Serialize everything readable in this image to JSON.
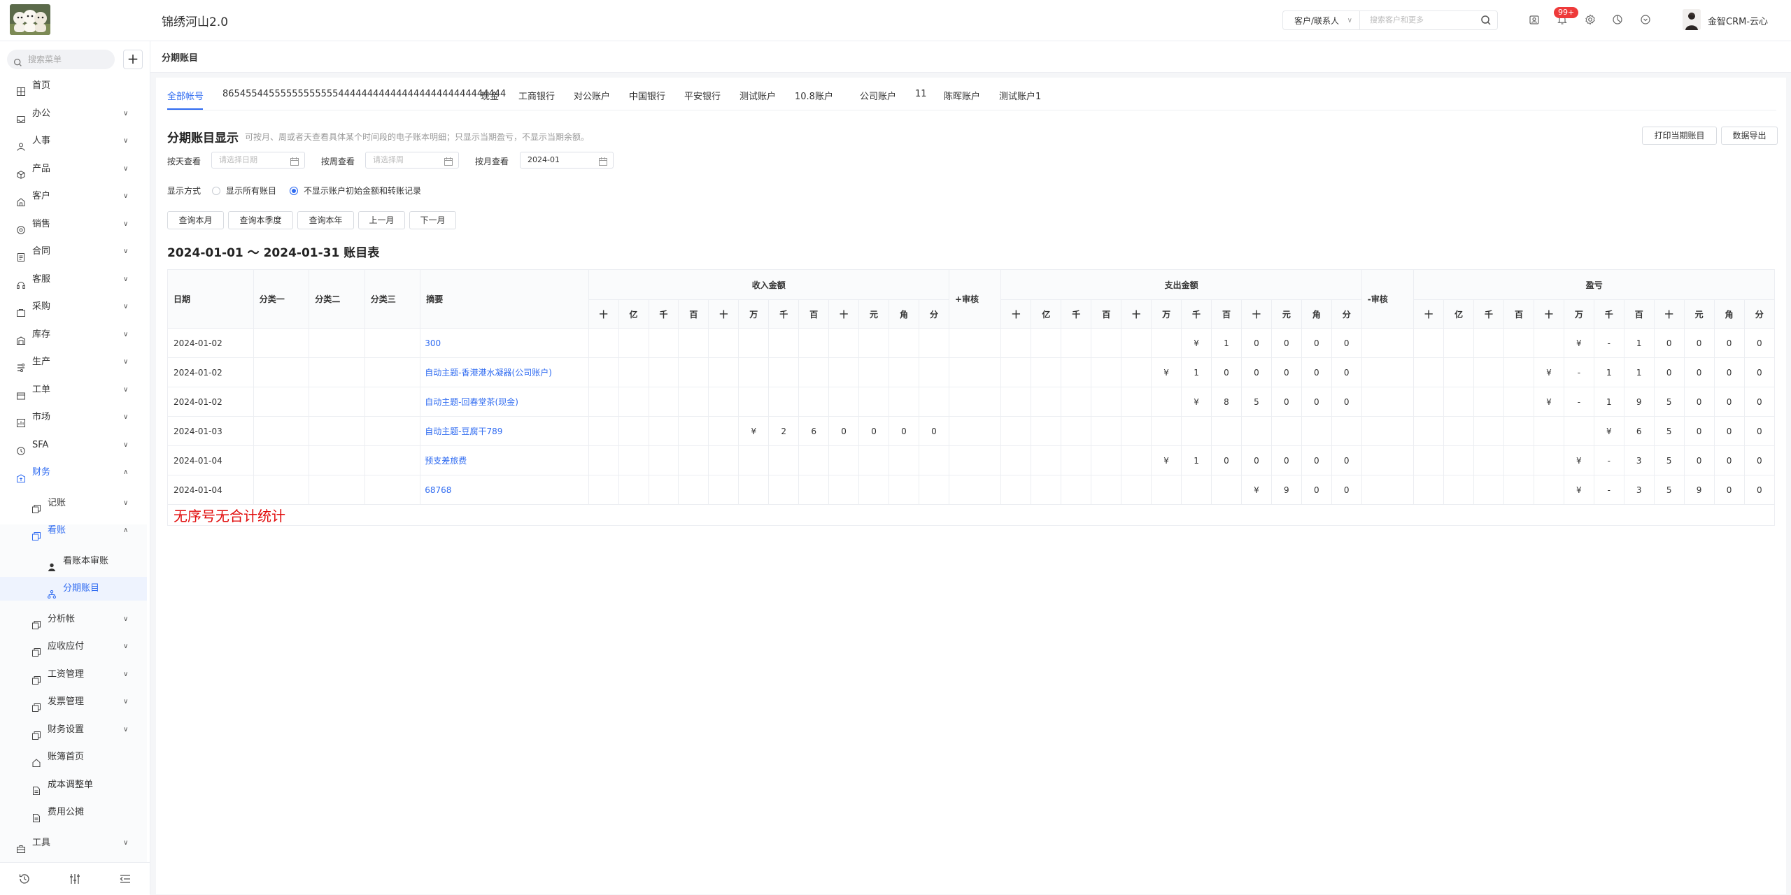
{
  "header": {
    "app_title": "锦绣河山2.0",
    "contact_type": "客户/联系人",
    "search_placeholder": "搜索客户和更多",
    "notif_count": "99+",
    "user_name": "金智CRM-云心"
  },
  "sidebar": {
    "search_placeholder": "搜索菜单",
    "items": [
      {
        "label": "首页",
        "icon": "grid-icon"
      },
      {
        "label": "办公",
        "icon": "inbox-icon"
      },
      {
        "label": "人事",
        "icon": "person-icon"
      },
      {
        "label": "产品",
        "icon": "box-icon"
      },
      {
        "label": "客户",
        "icon": "customer-icon"
      },
      {
        "label": "销售",
        "icon": "sales-icon"
      },
      {
        "label": "合同",
        "icon": "contract-icon"
      },
      {
        "label": "客服",
        "icon": "service-icon"
      },
      {
        "label": "采购",
        "icon": "cart-icon"
      },
      {
        "label": "库存",
        "icon": "warehouse-icon"
      },
      {
        "label": "生产",
        "icon": "production-icon"
      },
      {
        "label": "工单",
        "icon": "ticket-icon"
      },
      {
        "label": "市场",
        "icon": "market-icon"
      },
      {
        "label": "SFA",
        "icon": "sfa-icon"
      },
      {
        "label": "财务",
        "icon": "finance-icon"
      }
    ],
    "finance_children": [
      {
        "label": "记账",
        "icon": "copy-icon"
      },
      {
        "label": "看账",
        "icon": "copy-icon"
      },
      {
        "label": "看账本审账",
        "icon": "user-icon"
      },
      {
        "label": "分期账目",
        "icon": "tree-icon"
      },
      {
        "label": "分析帐",
        "icon": "copy-icon"
      },
      {
        "label": "应收应付",
        "icon": "copy-icon"
      },
      {
        "label": "工资管理",
        "icon": "copy-icon"
      },
      {
        "label": "发票管理",
        "icon": "copy-icon"
      },
      {
        "label": "财务设置",
        "icon": "copy-icon"
      },
      {
        "label": "账簿首页",
        "icon": "home-icon"
      },
      {
        "label": "成本调整单",
        "icon": "doc-icon"
      },
      {
        "label": "费用公摊",
        "icon": "doc-icon"
      }
    ],
    "tools_label": "工具"
  },
  "breadcrumb": {
    "title": "分期账目"
  },
  "tabs": [
    "全部帐号",
    "8654554455555555555544444444444444444444444444444",
    "现金",
    "工商银行",
    "对公账户",
    "中国银行",
    "平安银行",
    "测试账户",
    "10.8账户",
    "公司账户",
    "11",
    "陈晖账户",
    "测试账户1"
  ],
  "section": {
    "title": "分期账目显示",
    "hint": "可按月、周或者天查看具体某个时间段的电子账本明细；只显示当期盈亏，不显示当期余额。",
    "print_button": "打印当期账目",
    "export_button": "数据导出"
  },
  "filters": {
    "by_day_label": "按天查看",
    "by_day_placeholder": "请选择日期",
    "by_week_label": "按周查看",
    "by_week_placeholder": "请选择周",
    "by_month_label": "按月查看",
    "by_month_value": "2024-01",
    "display_label": "显示方式",
    "option_all": "显示所有账目",
    "option_hide": "不显示账户初始金额和转账记录",
    "quick_buttons": [
      "查询本月",
      "查询本季度",
      "查询本年",
      "上一月",
      "下一月"
    ]
  },
  "ledger": {
    "title": "2024-01-01 ～ 2024-01-31 账目表",
    "headers": {
      "date": "日期",
      "cat1": "分类一",
      "cat2": "分类二",
      "cat3": "分类三",
      "summary": "摘要",
      "income": "收入金额",
      "income_audit": "+审核",
      "expense": "支出金额",
      "expense_audit": "-审核",
      "profit": "盈亏"
    },
    "digits": [
      "十",
      "亿",
      "千",
      "百",
      "十",
      "万",
      "千",
      "百",
      "十",
      "元",
      "角",
      "分"
    ],
    "rows": [
      {
        "date": "2024-01-02",
        "summary": "300",
        "income": [
          "",
          "",
          "",
          "",
          "",
          "",
          "",
          "",
          "",
          "",
          "",
          ""
        ],
        "expense": [
          "",
          "",
          "",
          "",
          "",
          "",
          "¥",
          "1",
          "0",
          "0",
          "0",
          "0"
        ],
        "profit": [
          "",
          "",
          "",
          "",
          "",
          "¥",
          "-",
          "1",
          "0",
          "0",
          "0",
          "0"
        ]
      },
      {
        "date": "2024-01-02",
        "summary": "自动主题-香港港水凝器(公司账户)",
        "income": [
          "",
          "",
          "",
          "",
          "",
          "",
          "",
          "",
          "",
          "",
          "",
          ""
        ],
        "expense": [
          "",
          "",
          "",
          "",
          "",
          "¥",
          "1",
          "0",
          "0",
          "0",
          "0",
          "0"
        ],
        "profit": [
          "",
          "",
          "",
          "",
          "¥",
          "-",
          "1",
          "1",
          "0",
          "0",
          "0",
          "0"
        ]
      },
      {
        "date": "2024-01-02",
        "summary": "自动主题-回春堂茶(现金)",
        "income": [
          "",
          "",
          "",
          "",
          "",
          "",
          "",
          "",
          "",
          "",
          "",
          ""
        ],
        "expense": [
          "",
          "",
          "",
          "",
          "",
          "",
          "¥",
          "8",
          "5",
          "0",
          "0",
          "0"
        ],
        "profit": [
          "",
          "",
          "",
          "",
          "¥",
          "-",
          "1",
          "9",
          "5",
          "0",
          "0",
          "0"
        ]
      },
      {
        "date": "2024-01-03",
        "summary": "自动主题-豆腐干789",
        "income": [
          "",
          "",
          "",
          "",
          "",
          "¥",
          "2",
          "6",
          "0",
          "0",
          "0",
          "0"
        ],
        "expense": [
          "",
          "",
          "",
          "",
          "",
          "",
          "",
          "",
          "",
          "",
          "",
          ""
        ],
        "profit": [
          "",
          "",
          "",
          "",
          "",
          "",
          "¥",
          "6",
          "5",
          "0",
          "0",
          "0"
        ]
      },
      {
        "date": "2024-01-04",
        "summary": "预支差旅费",
        "income": [
          "",
          "",
          "",
          "",
          "",
          "",
          "",
          "",
          "",
          "",
          "",
          ""
        ],
        "expense": [
          "",
          "",
          "",
          "",
          "",
          "¥",
          "1",
          "0",
          "0",
          "0",
          "0",
          "0"
        ],
        "profit": [
          "",
          "",
          "",
          "",
          "",
          "¥",
          "-",
          "3",
          "5",
          "0",
          "0",
          "0"
        ]
      },
      {
        "date": "2024-01-04",
        "summary": "68768",
        "income": [
          "",
          "",
          "",
          "",
          "",
          "",
          "",
          "",
          "",
          "",
          "",
          ""
        ],
        "expense": [
          "",
          "",
          "",
          "",
          "",
          "",
          "",
          "",
          "¥",
          "9",
          "0",
          "0"
        ],
        "profit": [
          "",
          "",
          "",
          "",
          "",
          "¥",
          "-",
          "3",
          "5",
          "9",
          "0",
          "0"
        ]
      }
    ],
    "footer_note": "无序号无合计统计"
  }
}
